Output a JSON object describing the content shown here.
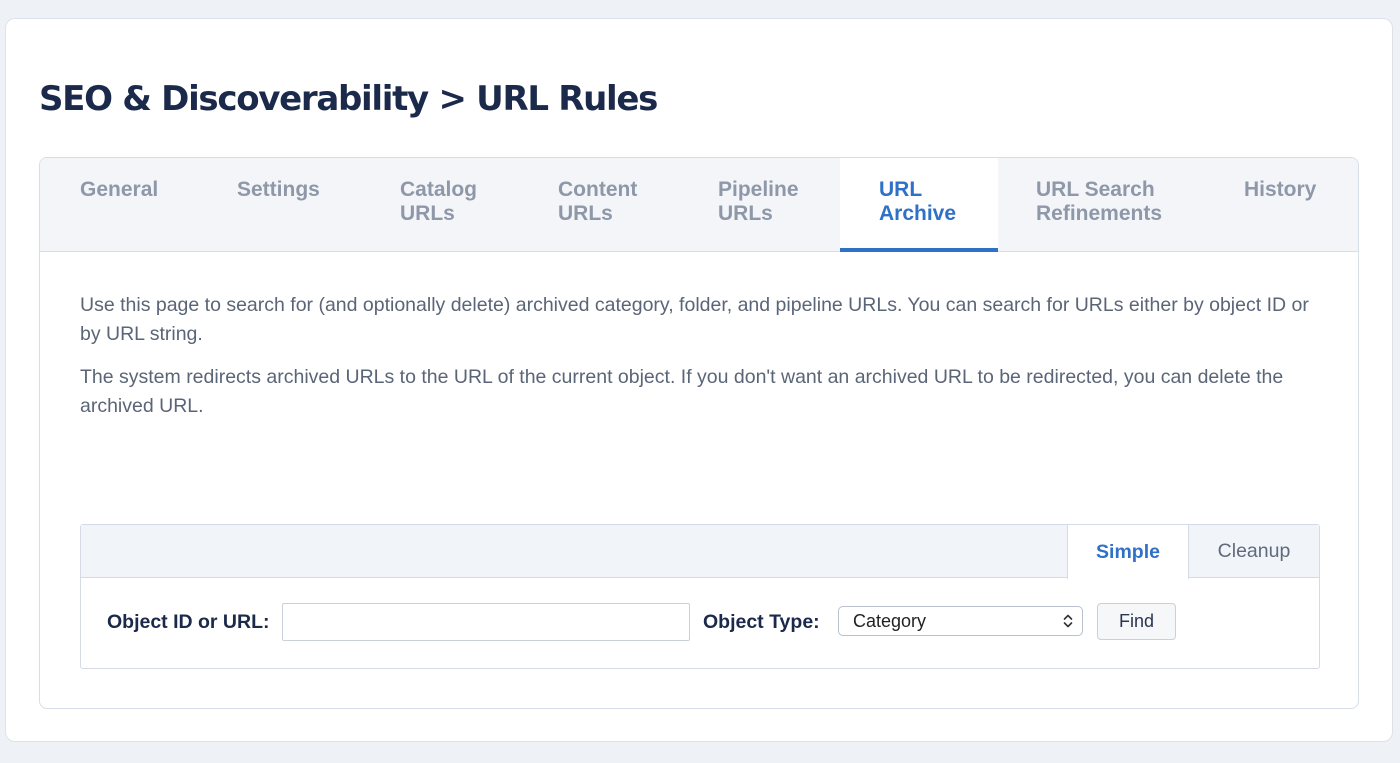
{
  "page": {
    "title": "SEO & Discoverability > URL Rules"
  },
  "tabs": [
    {
      "line1": "General",
      "line2": "",
      "active": false
    },
    {
      "line1": "Settings",
      "line2": "",
      "active": false
    },
    {
      "line1": "Catalog",
      "line2": "URLs",
      "active": false
    },
    {
      "line1": "Content",
      "line2": "URLs",
      "active": false
    },
    {
      "line1": "Pipeline",
      "line2": "URLs",
      "active": false
    },
    {
      "line1": "URL",
      "line2": "Archive",
      "active": true
    },
    {
      "line1": "URL Search",
      "line2": "Refinements",
      "active": false
    },
    {
      "line1": "History",
      "line2": "",
      "active": false
    }
  ],
  "description": {
    "paragraph1": "Use this page to search for (and optionally delete) archived category, folder, and pipeline URLs. You can search for URLs either by object ID or by URL string.",
    "paragraph2": "The system redirects archived URLs to the URL of the current object. If you don't want an archived URL to be redirected, you can delete the archived URL."
  },
  "search": {
    "modes": {
      "simple": "Simple",
      "cleanup": "Cleanup"
    },
    "active_mode": "Simple",
    "object_id_label": "Object ID or URL:",
    "object_id_value": "",
    "object_type_label": "Object Type:",
    "object_type_selected": "Category",
    "find_button": "Find"
  },
  "colors": {
    "accent": "#2f71c7",
    "title": "#1b2a4a",
    "tab_inactive": "#8e98a8",
    "body_text": "#5a6577",
    "page_background": "#eef1f5"
  },
  "icons": {
    "select_arrows": "chevron-up-down-icon"
  }
}
